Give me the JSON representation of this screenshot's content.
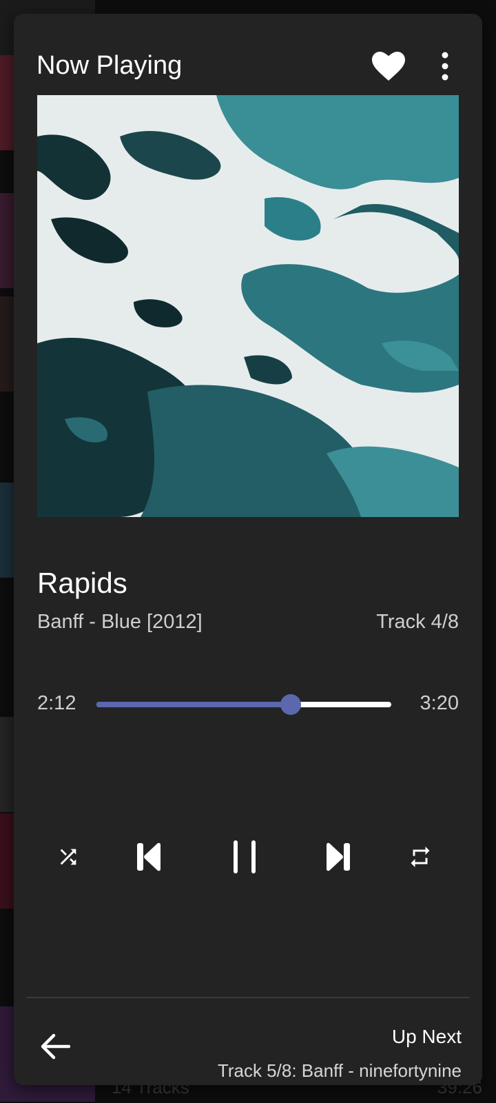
{
  "header": {
    "title": "Now Playing",
    "favorite_icon": "heart-icon",
    "menu_icon": "more-vertical-icon"
  },
  "album_art": {
    "description_colors": [
      "#1e4f56",
      "#2f7c84",
      "#eef2f1",
      "#0f2e33"
    ]
  },
  "track": {
    "title": "Rapids",
    "subtitle": "Banff - Blue [2012]",
    "position": "Track 4/8"
  },
  "progress": {
    "elapsed": "2:12",
    "total": "3:20",
    "fraction": 0.66
  },
  "controls": {
    "shuffle_icon": "shuffle-icon",
    "previous_icon": "skip-previous-icon",
    "play_pause_icon": "pause-icon",
    "next_icon": "skip-next-icon",
    "repeat_icon": "repeat-icon"
  },
  "footer": {
    "back_icon": "arrow-left-icon",
    "up_next_label": "Up Next",
    "up_next_track": "Track 5/8: Banff - ninefortynine"
  },
  "background_list": {
    "tracks_count": "14 Tracks",
    "duration": "39:26"
  },
  "colors": {
    "card_bg": "#232323",
    "accent": "#5b68ad",
    "text_primary": "#ffffff",
    "text_secondary": "#cfcfcf"
  }
}
